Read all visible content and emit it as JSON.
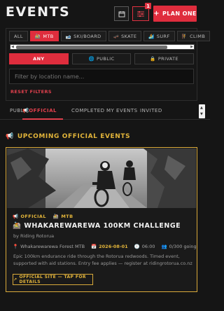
{
  "header": {
    "title": "EVENTS",
    "notification_count": "1",
    "plan_label": "PLAN ONE"
  },
  "categories": [
    {
      "label": "ALL",
      "icon": "none",
      "active": false
    },
    {
      "label": "MTB",
      "icon": "bike-icon",
      "active": true
    },
    {
      "label": "SKI/BOARD",
      "icon": "ski-icon",
      "active": false
    },
    {
      "label": "SKATE",
      "icon": "skate-icon",
      "active": false
    },
    {
      "label": "SURF",
      "icon": "surf-icon",
      "active": false
    },
    {
      "label": "CLIMB",
      "icon": "climb-icon",
      "active": false
    }
  ],
  "visibility": {
    "any": "ANY",
    "public": "PUBLIC",
    "private": "PRIVATE"
  },
  "location_filter": {
    "placeholder": "Filter by location name..."
  },
  "reset_label": "RESET FILTERS",
  "tabs": [
    {
      "label": "PUBLIC"
    },
    {
      "label": "OFFICIAL"
    },
    {
      "label": "COMPLETED"
    },
    {
      "label": "MY EVENTS"
    },
    {
      "label": "INVITED"
    }
  ],
  "section_title": "UPCOMING OFFICIAL EVENTS",
  "event": {
    "tag_official": "OFFICIAL",
    "tag_sport": "MTB",
    "title": "WHAKAREWAREWA 100KM CHALLENGE",
    "organizer": "by Riding Rotorua",
    "location": "Whakarewarewa Forest MTB",
    "date": "2026-08-01",
    "time": "06:00",
    "attendance": "0/300 going",
    "description_line1": "Epic 100km endurance ride through the Rotorua redwoods. Timed event,",
    "description_line2": "supported with aid stations. Entry fee applies — register at ridingrotorua.co.nz...",
    "site_button": "OFFICIAL SITE — TAP FOR DETAILS"
  },
  "colors": {
    "accent_red": "#df2d3d",
    "accent_gold": "#e3b53a",
    "background": "#151515"
  }
}
